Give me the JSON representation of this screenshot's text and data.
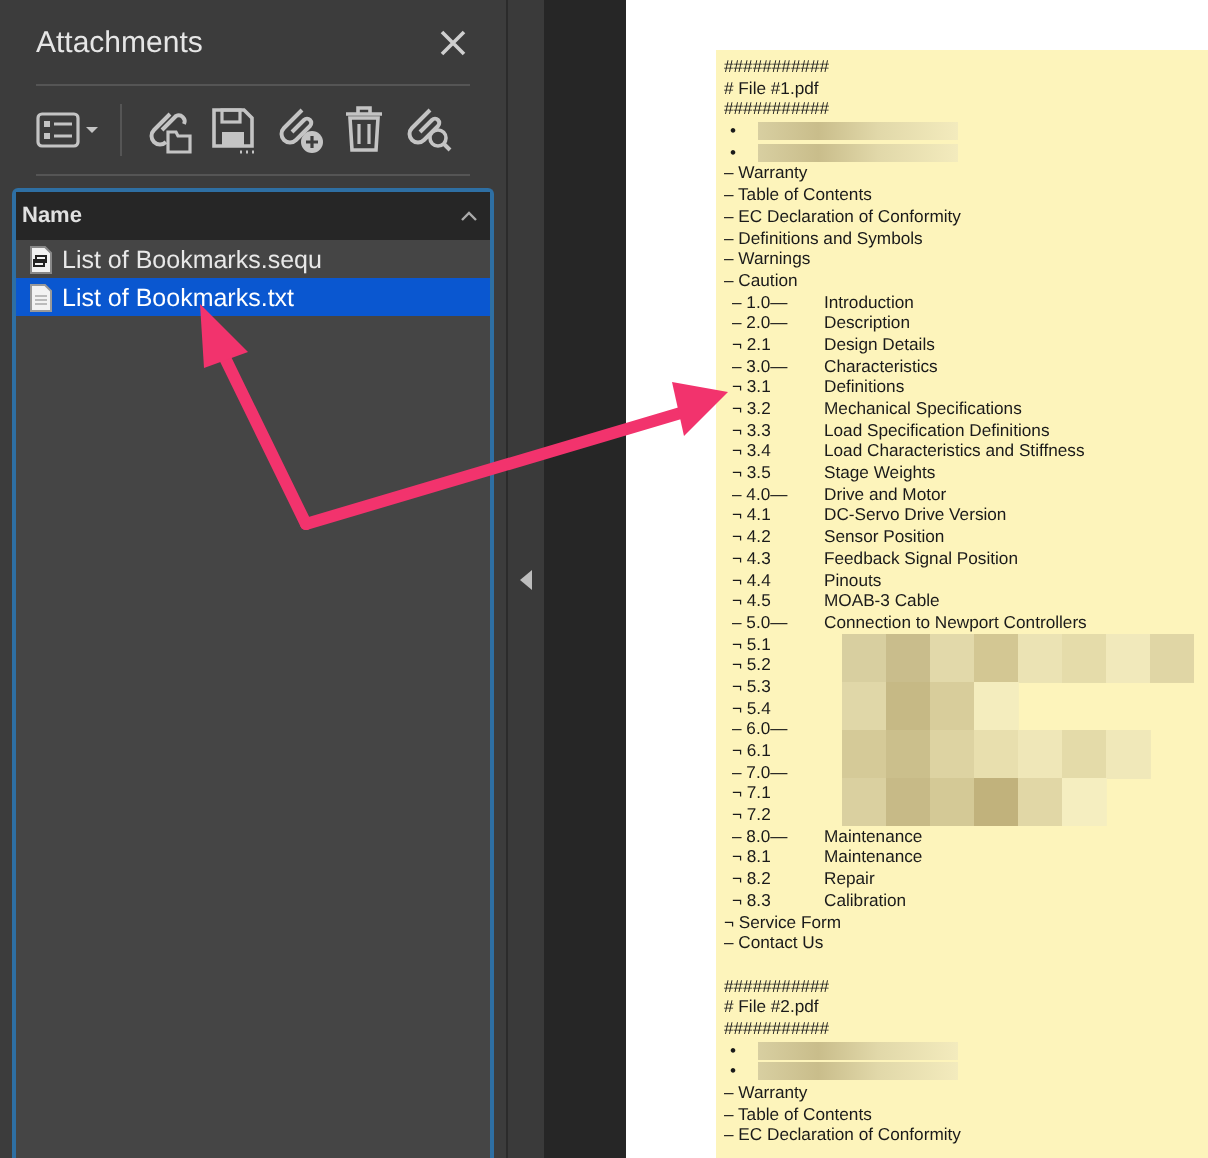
{
  "panel": {
    "title": "Attachments"
  },
  "list": {
    "header": "Name",
    "items": [
      {
        "name": "List of Bookmarks.sequ",
        "kind": "sequence",
        "selected": false
      },
      {
        "name": "List of Bookmarks.txt",
        "kind": "text",
        "selected": true
      }
    ]
  },
  "document": {
    "lines": [
      {
        "kind": "plain",
        "text": "###########"
      },
      {
        "kind": "plain",
        "text": "# File #1.pdf"
      },
      {
        "kind": "plain",
        "text": "###########"
      },
      {
        "kind": "redacted",
        "prefix": "•"
      },
      {
        "kind": "redacted",
        "prefix": "•"
      },
      {
        "kind": "plain",
        "text": "– Warranty"
      },
      {
        "kind": "plain",
        "text": "– Table of Contents"
      },
      {
        "kind": "plain",
        "text": "– EC Declaration of Conformity"
      },
      {
        "kind": "plain",
        "text": "– Definitions and Symbols"
      },
      {
        "kind": "plain",
        "text": "– Warnings"
      },
      {
        "kind": "plain",
        "text": "– Caution"
      },
      {
        "kind": "entry",
        "prefix": "– 1.0—",
        "title": "Introduction"
      },
      {
        "kind": "entry",
        "prefix": "– 2.0—",
        "title": "Description"
      },
      {
        "kind": "entry",
        "prefix": "¬ 2.1",
        "title": "Design Details"
      },
      {
        "kind": "entry",
        "prefix": "– 3.0—",
        "title": "Characteristics"
      },
      {
        "kind": "entry",
        "prefix": "¬ 3.1",
        "title": "Definitions"
      },
      {
        "kind": "entry",
        "prefix": "¬ 3.2",
        "title": "Mechanical Specifications"
      },
      {
        "kind": "entry",
        "prefix": "¬ 3.3",
        "title": "Load Specification Definitions"
      },
      {
        "kind": "entry",
        "prefix": "¬ 3.4",
        "title": "Load Characteristics and Stiffness"
      },
      {
        "kind": "entry",
        "prefix": "¬ 3.5",
        "title": "Stage Weights"
      },
      {
        "kind": "entry",
        "prefix": "– 4.0—",
        "title": "Drive and Motor"
      },
      {
        "kind": "entry",
        "prefix": "¬ 4.1",
        "title": "DC-Servo Drive Version"
      },
      {
        "kind": "entry",
        "prefix": "¬ 4.2",
        "title": "Sensor Position"
      },
      {
        "kind": "entry",
        "prefix": "¬ 4.3",
        "title": "Feedback Signal Position"
      },
      {
        "kind": "entry",
        "prefix": "¬ 4.4",
        "title": "Pinouts"
      },
      {
        "kind": "entry",
        "prefix": "¬ 4.5",
        "title": "MOAB-3 Cable"
      },
      {
        "kind": "entry",
        "prefix": "– 5.0—",
        "title": "Connection to Newport Controllers"
      },
      {
        "kind": "blurred",
        "prefix": "¬ 5.1"
      },
      {
        "kind": "blurred",
        "prefix": "¬ 5.2"
      },
      {
        "kind": "blurred",
        "prefix": "¬ 5.3"
      },
      {
        "kind": "blurred",
        "prefix": "¬ 5.4"
      },
      {
        "kind": "blurred",
        "prefix": "– 6.0—"
      },
      {
        "kind": "blurred",
        "prefix": "¬ 6.1"
      },
      {
        "kind": "blurred",
        "prefix": "– 7.0—"
      },
      {
        "kind": "blurred",
        "prefix": "¬ 7.1"
      },
      {
        "kind": "blurred",
        "prefix": "¬ 7.2"
      },
      {
        "kind": "entry",
        "prefix": "– 8.0—",
        "title": "Maintenance"
      },
      {
        "kind": "entry",
        "prefix": "¬ 8.1",
        "title": "Maintenance"
      },
      {
        "kind": "entry",
        "prefix": "¬ 8.2",
        "title": "Repair"
      },
      {
        "kind": "entry",
        "prefix": "¬ 8.3",
        "title": "Calibration"
      },
      {
        "kind": "plain",
        "text": "¬ Service Form"
      },
      {
        "kind": "plain",
        "text": "– Contact Us"
      },
      {
        "kind": "blank"
      },
      {
        "kind": "plain",
        "text": "###########"
      },
      {
        "kind": "plain",
        "text": "# File #2.pdf"
      },
      {
        "kind": "plain",
        "text": "###########"
      },
      {
        "kind": "redacted",
        "prefix": "•"
      },
      {
        "kind": "redacted",
        "prefix": "•"
      },
      {
        "kind": "plain",
        "text": "– Warranty"
      },
      {
        "kind": "plain",
        "text": "– Table of Contents"
      },
      {
        "kind": "plain",
        "text": "– EC Declaration of Conformity"
      }
    ]
  }
}
